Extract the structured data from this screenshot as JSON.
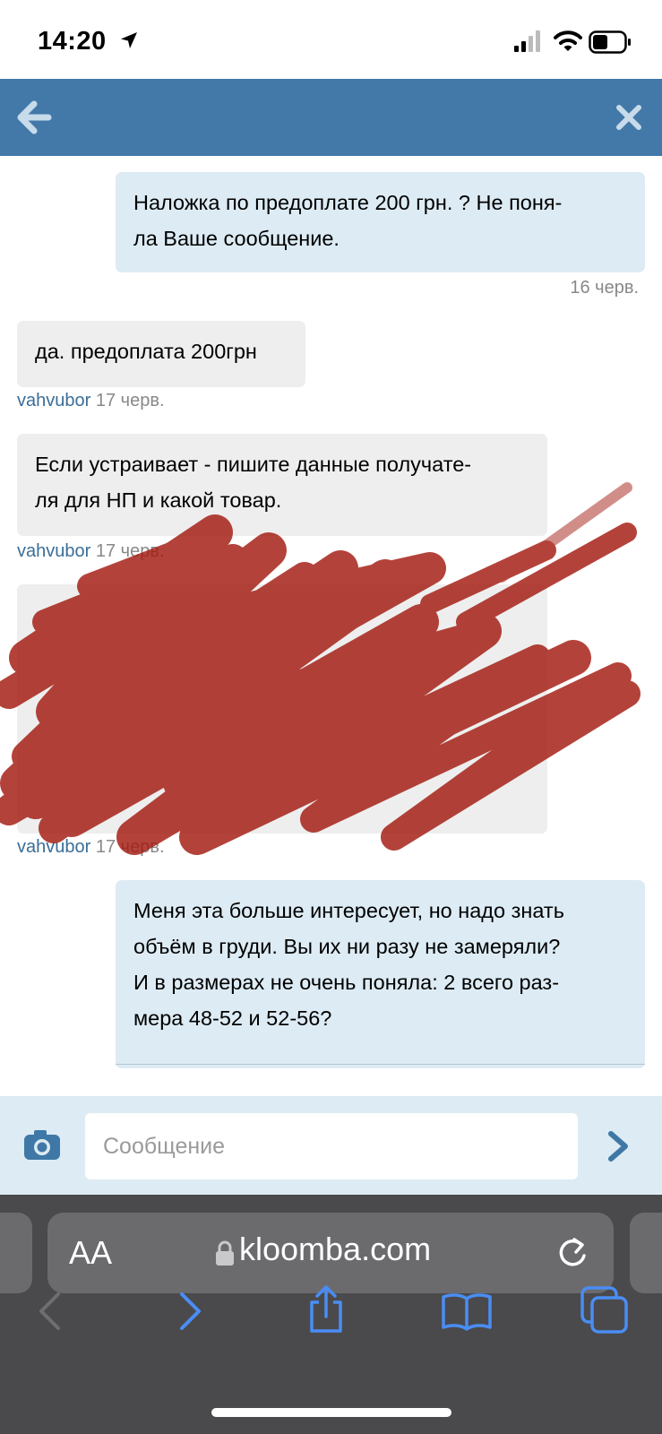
{
  "status_bar": {
    "time": "14:20",
    "icons": [
      "location-arrow-icon",
      "signal-icon",
      "wifi-icon",
      "battery-icon"
    ]
  },
  "header": {
    "back_icon": "arrow-left-icon",
    "close_icon": "close-x-icon",
    "color": "#4279a8"
  },
  "messages": [
    {
      "direction": "out",
      "text": "Наложка по предоплате 200 грн. ? Не поня-\nла Ваше сообщение.",
      "date": "16 черв."
    },
    {
      "direction": "in",
      "text": "да. предоплата 200грн",
      "author": "vahvubor",
      "date": "17 черв."
    },
    {
      "direction": "in",
      "text": "Если устраивает - пишите данные получате-\nля для НП и какой товар.",
      "author": "vahvubor",
      "date": "17 черв."
    },
    {
      "direction": "in",
      "text": "",
      "author": "vahvubor",
      "date": "17 черв.",
      "redacted": true
    },
    {
      "direction": "out",
      "text": "Меня эта больше интересует, но надо знать\nобъём в груди. Вы их ни разу не замеряли?\nИ в размерах не очень поняла: 2 всего раз-\nмера 48-52 и 52-56?"
    }
  ],
  "compose": {
    "placeholder": "Сообщение",
    "camera_icon": "camera-icon",
    "send_icon": "chevron-right-icon"
  },
  "safari": {
    "aa_label": "AA",
    "url": "kloomba.com",
    "lock_icon": "lock-icon",
    "reload_icon": "reload-icon",
    "toolbar": [
      "back-icon",
      "forward-icon",
      "share-icon",
      "bookmarks-icon",
      "tabs-icon"
    ]
  },
  "colors": {
    "outgoing_bubble": "#ddebf4",
    "incoming_bubble": "#eeeeee",
    "author": "#3b6e98",
    "redaction": "#a31a10"
  }
}
